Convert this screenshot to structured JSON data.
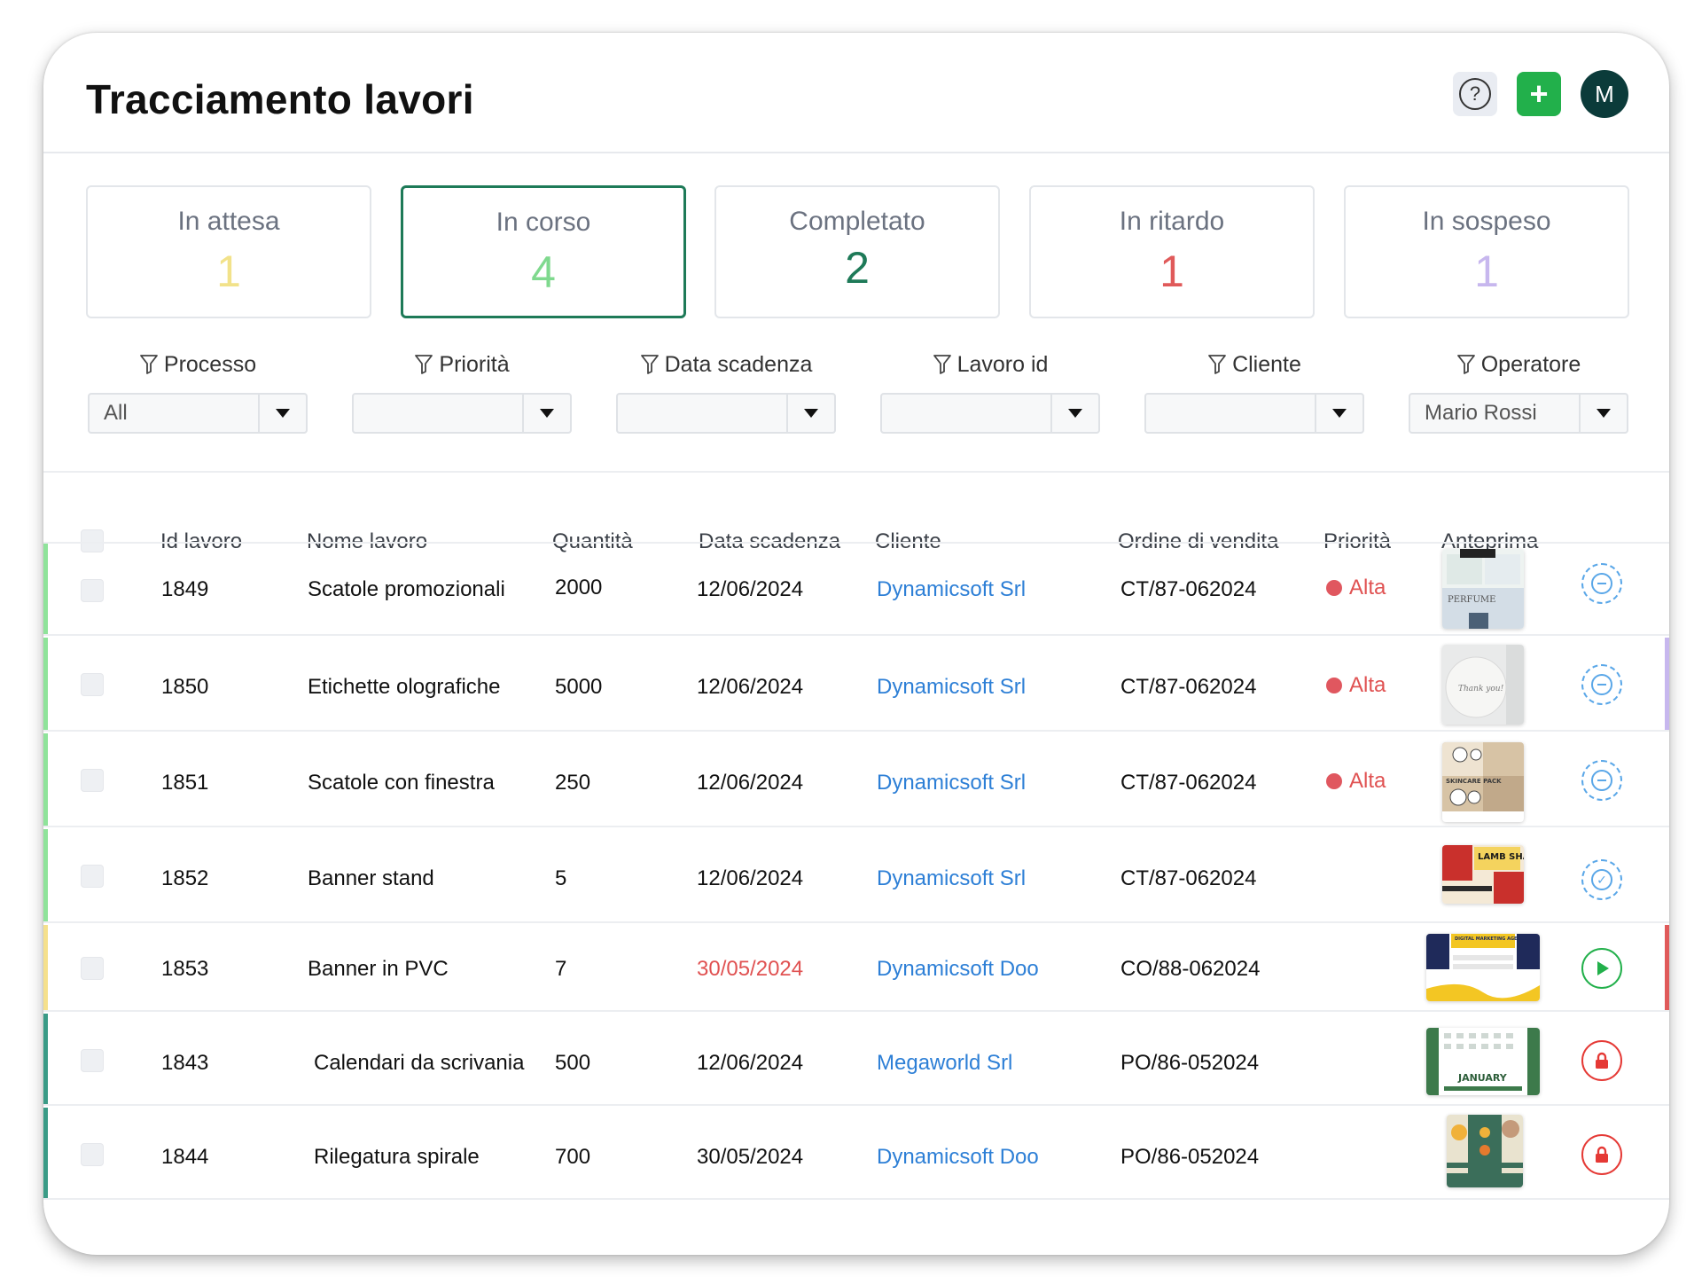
{
  "header": {
    "title": "Tracciamento lavori",
    "help_icon": "question-circle-icon",
    "add_icon": "plus-icon",
    "avatar_initial": "M",
    "colors": {
      "add": "#22b04b",
      "avatar": "#0b3b3a"
    }
  },
  "status_cards": [
    {
      "label": "In attesa",
      "count": "1",
      "color": "#f2e28a"
    },
    {
      "label": "In corso",
      "count": "4",
      "color": "#7fd98e",
      "active": true
    },
    {
      "label": "Completato",
      "count": "2",
      "color": "#1e7a58"
    },
    {
      "label": "In ritardo",
      "count": "1",
      "color": "#e05a5a"
    },
    {
      "label": "In sospeso",
      "count": "1",
      "color": "#c7b7ee"
    }
  ],
  "filters": [
    {
      "label": "Processo",
      "value": "All"
    },
    {
      "label": "Priorità",
      "value": ""
    },
    {
      "label": "Data scadenza",
      "value": ""
    },
    {
      "label": "Lavoro id",
      "value": ""
    },
    {
      "label": "Cliente",
      "value": ""
    },
    {
      "label": "Operatore",
      "value": "Mario Rossi"
    }
  ],
  "table": {
    "columns": [
      "Id lavoro",
      "Nome lavoro",
      "Quantità",
      "Data scadenza",
      "Cliente",
      "Ordine di vendita",
      "Priorità",
      "Anteprima"
    ],
    "rows": [
      {
        "id": "1849",
        "name": "Scatole promozionali",
        "qty": "2000",
        "due": "12/06/2024",
        "client": "Dynamicsoft Srl",
        "order": "CT/87-062024",
        "priority": "Alta",
        "late": false,
        "status_color": "#8fe39a",
        "action": "pending"
      },
      {
        "id": "1850",
        "name": "Etichette olografiche",
        "qty": "5000",
        "due": "12/06/2024",
        "client": "Dynamicsoft Srl",
        "order": "CT/87-062024",
        "priority": "Alta",
        "late": false,
        "status_color": "#8fe39a",
        "action": "pending"
      },
      {
        "id": "1851",
        "name": "Scatole con finestra",
        "qty": "250",
        "due": "12/06/2024",
        "client": "Dynamicsoft Srl",
        "order": "CT/87-062024",
        "priority": "Alta",
        "late": false,
        "status_color": "#8fe39a",
        "action": "pending"
      },
      {
        "id": "1852",
        "name": "Banner stand",
        "qty": "5",
        "due": "12/06/2024",
        "client": "Dynamicsoft Srl",
        "order": "CT/87-062024",
        "priority": "",
        "late": false,
        "status_color": "#8fe39a",
        "action": "pending"
      },
      {
        "id": "1853",
        "name": "Banner in PVC",
        "qty": "7",
        "due": "30/05/2024",
        "client": "Dynamicsoft Doo",
        "order": "CO/88-062024",
        "priority": "",
        "late": true,
        "status_color": "#f5e08c",
        "action": "play"
      },
      {
        "id": "1843",
        "name": "Calendari da scrivania",
        "qty": "500",
        "due": "12/06/2024",
        "client": "Megaworld Srl",
        "order": "PO/86-052024",
        "priority": "",
        "late": false,
        "status_color": "#3a9b86",
        "action": "lock"
      },
      {
        "id": "1844",
        "name": "Rilegatura spirale",
        "qty": "700",
        "due": "30/05/2024",
        "client": "Dynamicsoft Doo",
        "order": "PO/86-052024",
        "priority": "",
        "late": false,
        "status_color": "#3a9b86",
        "action": "lock"
      }
    ],
    "thumbs": [
      {
        "text": "PERFUME"
      },
      {
        "text": "Thank you!"
      },
      {
        "text": "SKINCARE PACK"
      },
      {
        "text": "LAMB SHANK"
      },
      {
        "text": "DIGITAL MARKETING AGENCY"
      },
      {
        "text": "JANUARY"
      },
      {
        "text": ""
      }
    ]
  }
}
